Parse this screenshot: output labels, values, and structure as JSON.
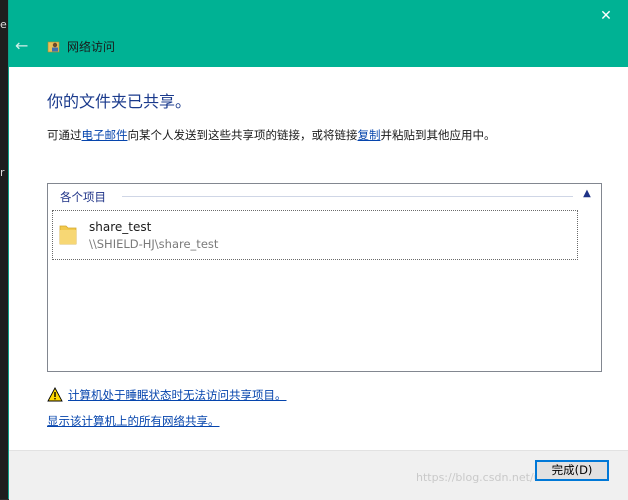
{
  "background": {
    "side_chars": [
      "e",
      "r"
    ]
  },
  "window": {
    "title": "网络访问",
    "back_icon": "back-arrow-icon",
    "close_icon": "close-icon",
    "accent_color": "#00b294"
  },
  "content": {
    "heading": "你的文件夹已共享。",
    "description": {
      "part1": "可通过",
      "email_link": "电子邮件",
      "part2": "向某个人发送到这些共享项的链接，或将链接",
      "copy_link": "复制",
      "part3": "并粘贴到其他应用中。"
    },
    "group": {
      "header": "各个项目",
      "items": [
        {
          "name": "share_test",
          "path": "\\\\SHIELD-HJ\\share_test",
          "icon": "folder-icon"
        }
      ]
    },
    "sleep_warning_link": "计算机处于睡眠状态时无法访问共享项目。",
    "show_all_shares_link": "显示该计算机上的所有网络共享。"
  },
  "footer": {
    "finish_button": "完成(D)",
    "watermark": "https://blog.csdn.net/u0...96"
  }
}
